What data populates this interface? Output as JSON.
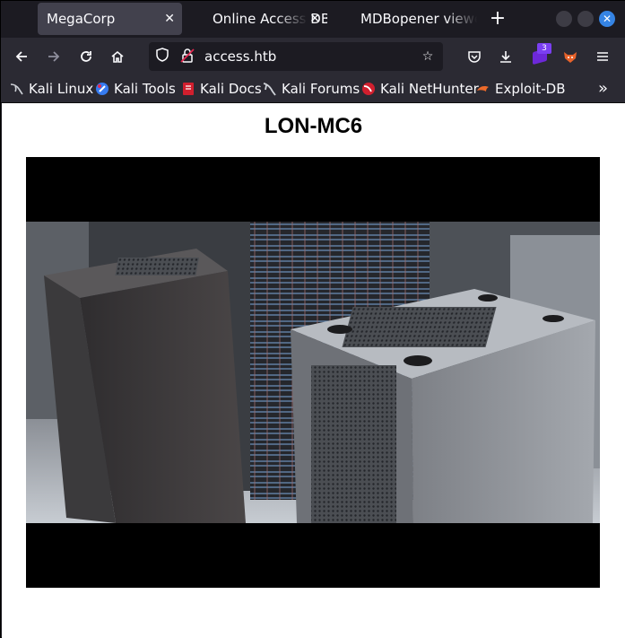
{
  "browser": {
    "tabs": [
      {
        "title": "MegaCorp",
        "active": true
      },
      {
        "title": "Online Access DB",
        "active": false
      },
      {
        "title": "MDBopener viewer",
        "active": false
      }
    ],
    "url": "access.htb",
    "extension_badge": "3"
  },
  "bookmarks": [
    {
      "label": "Kali Linux",
      "icon": "kali-dragon-icon"
    },
    {
      "label": "Kali Tools",
      "icon": "kali-tools-icon"
    },
    {
      "label": "Kali Docs",
      "icon": "kali-docs-icon"
    },
    {
      "label": "Kali Forums",
      "icon": "kali-forums-icon"
    },
    {
      "label": "Kali NetHunter",
      "icon": "kali-nethunter-icon"
    },
    {
      "label": "Exploit-DB",
      "icon": "exploit-db-icon"
    }
  ],
  "page": {
    "title": "LON-MC6",
    "image_alt": "security camera still of server racks"
  },
  "colors": {
    "accent": "#3584e4",
    "tab_active": "#42414d",
    "toolbar": "#2b2a33"
  }
}
